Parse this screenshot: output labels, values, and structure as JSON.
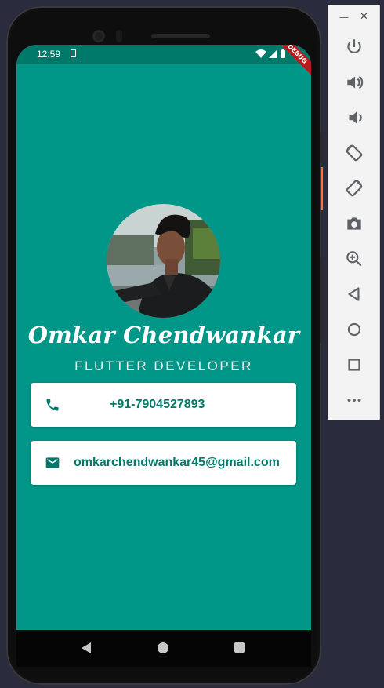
{
  "status_bar": {
    "time": "12:59",
    "debug_banner": "DEBUG"
  },
  "profile": {
    "name": "Omkar Chendwankar",
    "title": "FLUTTER DEVELOPER",
    "phone": "+91-7904527893",
    "email": "omkarchendwankar45@gmail.com"
  },
  "colors": {
    "background": "#009688",
    "status_bar": "#00796b",
    "card_text": "#00796b",
    "card_background": "#ffffff"
  },
  "icons": {
    "phone": "phone-icon",
    "email": "email-icon",
    "toolbar": [
      "power-icon",
      "volume-up-icon",
      "volume-down-icon",
      "rotate-left-icon",
      "rotate-right-icon",
      "camera-icon",
      "zoom-icon",
      "back-icon",
      "home-icon",
      "overview-icon",
      "more-icon"
    ]
  }
}
